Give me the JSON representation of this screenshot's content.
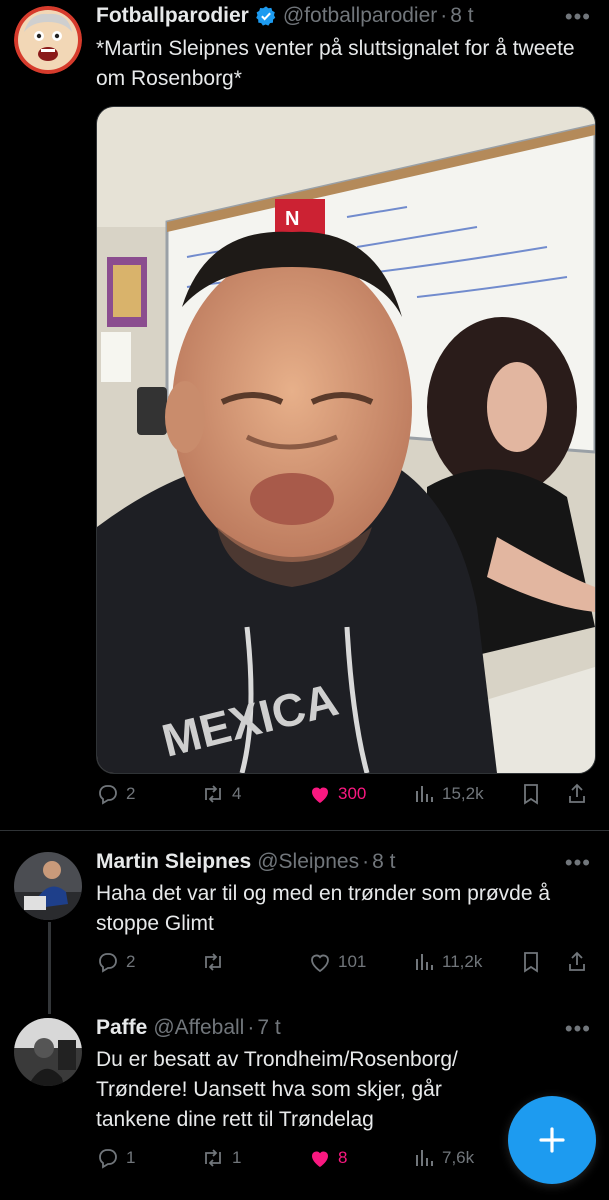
{
  "tweets": [
    {
      "name": "Fotballparodier",
      "verified": true,
      "handle": "@fotballparodier",
      "time": "8 t",
      "text": "*Martin Sleipnes venter på sluttsignalet for å tweete om Rosenborg*",
      "stats": {
        "replies": "2",
        "retweets": "4",
        "likes": "300",
        "views": "15,2k"
      },
      "liked": true
    },
    {
      "name": "Martin Sleipnes",
      "handle": "@Sleipnes",
      "time": "8 t",
      "text": "Haha det var til og med en trønder som prøvde å stoppe Glimt",
      "stats": {
        "replies": "2",
        "retweets": "",
        "likes": "101",
        "views": "11,2k"
      },
      "liked": false
    },
    {
      "name": "Paffe",
      "handle": "@Affeball",
      "time": "7 t",
      "text": "Du er besatt av Trondheim/Rosenborg/ Trøndere! Uansett hva som skjer, går tankene dine rett til Trøndelag",
      "stats": {
        "replies": "1",
        "retweets": "1",
        "likes": "8",
        "views": "7,6k"
      },
      "liked": true
    }
  ],
  "symbols": {
    "dot": "·",
    "more": "•••"
  },
  "icons": [
    "verified-badge-icon",
    "reply-icon",
    "retweet-icon",
    "like-icon",
    "views-icon",
    "bookmark-icon",
    "share-icon",
    "compose-plus-icon"
  ],
  "colors": {
    "accent": "#1d9bf0",
    "like": "#f91880",
    "muted": "#71767b",
    "text": "#e7e9ea"
  }
}
